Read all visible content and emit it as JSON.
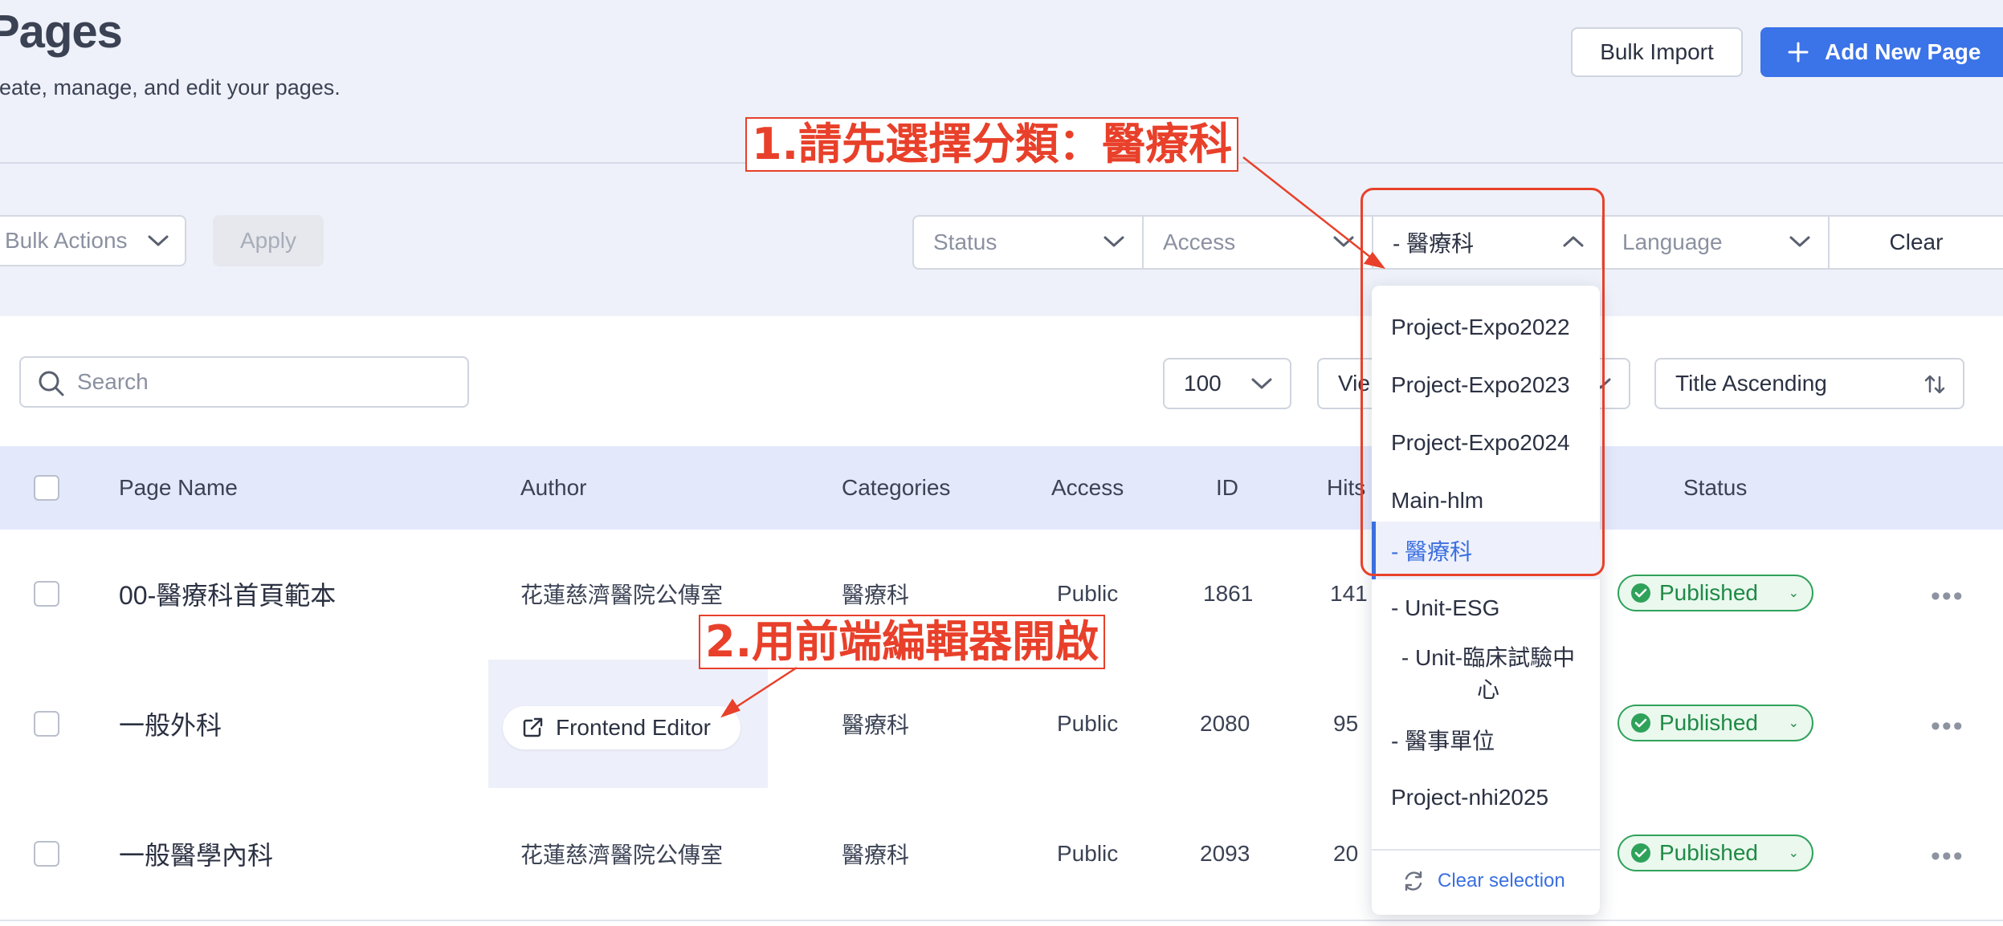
{
  "header": {
    "title": "Pages",
    "subtitle": "reate, manage, and edit your pages.",
    "bulk_import_label": "Bulk Import",
    "add_new_label": "Add New Page"
  },
  "toolbar": {
    "bulk_actions_label": "Bulk Actions",
    "apply_label": "Apply",
    "filters": {
      "status": "Status",
      "access": "Access",
      "category": "- 醫療科",
      "language": "Language",
      "clear": "Clear"
    }
  },
  "list_controls": {
    "search_placeholder": "Search",
    "per_page": "100",
    "view_partial": "Vie",
    "sort": "Title Ascending"
  },
  "table": {
    "columns": {
      "page_name": "Page Name",
      "author": "Author",
      "categories": "Categories",
      "access": "Access",
      "id": "ID",
      "hits": "Hits",
      "status": "Status"
    },
    "rows": [
      {
        "name": "00-醫療科首頁範本",
        "author": "花蓮慈濟醫院公傳室",
        "category": "醫療科",
        "access": "Public",
        "id": "1861",
        "hits": "141",
        "status": "Published"
      },
      {
        "name": "一般外科",
        "author": "",
        "category": "醫療科",
        "access": "Public",
        "id": "2080",
        "hits": "95",
        "status": "Published"
      },
      {
        "name": "一般醫學內科",
        "author": "花蓮慈濟醫院公傳室",
        "category": "醫療科",
        "access": "Public",
        "id": "2093",
        "hits": "20",
        "status": "Published"
      }
    ],
    "frontend_editor_label": "Frontend Editor"
  },
  "category_dropdown": {
    "items": [
      {
        "label": "Project-Expo2022",
        "selected": false
      },
      {
        "label": "Project-Expo2023",
        "selected": false
      },
      {
        "label": "Project-Expo2024",
        "selected": false
      },
      {
        "label": "Main-hlm",
        "selected": false
      },
      {
        "label": "- 醫療科",
        "selected": true
      },
      {
        "label": "- Unit-ESG",
        "selected": false
      },
      {
        "label": "- Unit-臨床試驗中心",
        "selected": false
      },
      {
        "label": "- 醫事單位",
        "selected": false
      },
      {
        "label": "Project-nhi2025",
        "selected": false
      }
    ],
    "clear_selection_label": "Clear selection"
  },
  "annotations": {
    "step1": "1.請先選擇分類：醫療科",
    "step2": "2.用前端編輯器開啟"
  },
  "colors": {
    "primary": "#3b73e8",
    "published": "#2fa25a",
    "annotation": "#e8402a"
  }
}
